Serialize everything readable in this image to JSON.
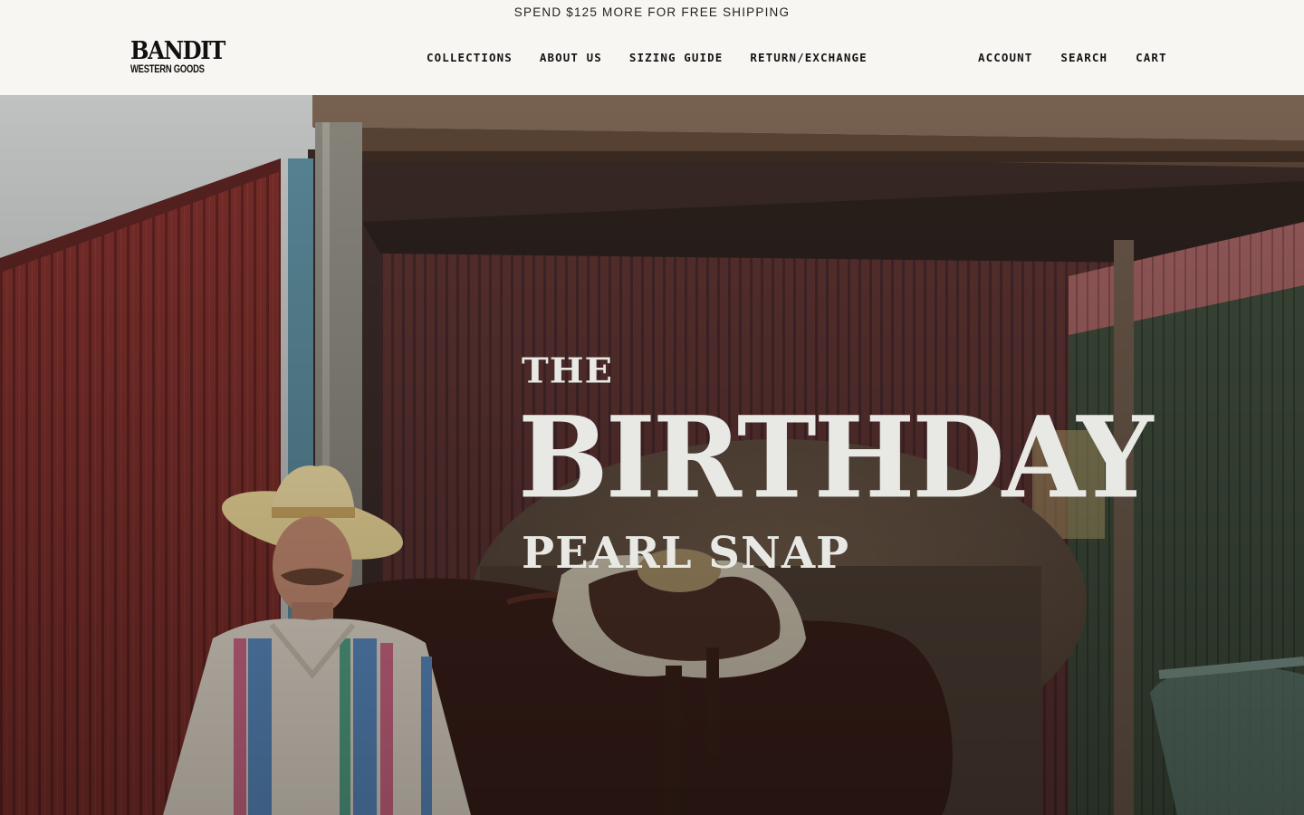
{
  "announcement": "SPEND $125 MORE FOR FREE SHIPPING",
  "logo": {
    "main": "BANDIT",
    "sub": "WESTERN GOODS"
  },
  "nav": {
    "main": [
      "Collections",
      "About Us",
      "Sizing Guide",
      "Return/Exchange"
    ],
    "utility": [
      "Account",
      "Search",
      "Cart"
    ]
  },
  "hero": {
    "line1": "THE",
    "line2": "BIRTHDAY",
    "line3": "PEARL SNAP"
  },
  "colors": {
    "background": "#f7f6f2",
    "barn_red": "#7a2e2c",
    "headline": "#e8e8e4"
  }
}
